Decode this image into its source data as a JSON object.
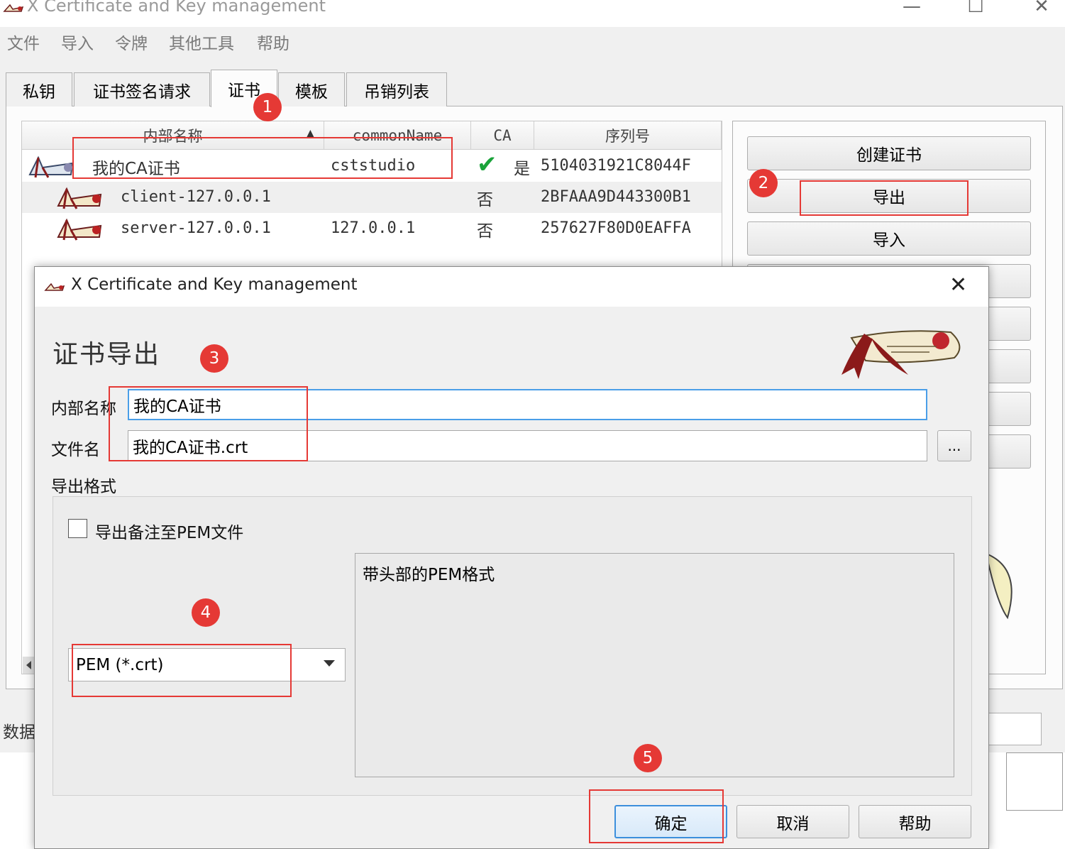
{
  "app": {
    "title": "X Certificate and Key management",
    "window_controls": {
      "minimize": "—",
      "maximize": "☐",
      "close": "✕"
    }
  },
  "menu": [
    "文件",
    "导入",
    "令牌",
    "其他工具",
    "帮助"
  ],
  "tabs": [
    {
      "label": "私钥",
      "active": false
    },
    {
      "label": "证书签名请求",
      "active": false
    },
    {
      "label": "证书",
      "active": true
    },
    {
      "label": "模板",
      "active": false
    },
    {
      "label": "吊销列表",
      "active": false
    }
  ],
  "cert_table": {
    "columns": [
      "内部名称",
      "commonName",
      "CA",
      "序列号"
    ],
    "sort_indicator": "▲",
    "rows": [
      {
        "name": "我的CA证书",
        "common_name": "cststudio",
        "ca": "是",
        "ca_check": "✔",
        "serial": "5104031921C8044F"
      },
      {
        "name": "client-127.0.0.1",
        "common_name": "",
        "ca": "否",
        "ca_check": "",
        "serial": "2BFAAA9D443300B1"
      },
      {
        "name": "server-127.0.0.1",
        "common_name": "127.0.0.1",
        "ca": "否",
        "ca_check": "",
        "serial": "257627F80D0EAFFA"
      }
    ]
  },
  "side_buttons": [
    "创建证书",
    "导出",
    "导入"
  ],
  "status_label": "数据",
  "dialog": {
    "title": "X Certificate and Key management",
    "close": "✕",
    "heading": "证书导出",
    "internal_name_label": "内部名称",
    "internal_name_value": "我的CA证书",
    "filename_label": "文件名",
    "filename_value": "我的CA证书.crt",
    "browse_label": "...",
    "format_label": "导出格式",
    "checkbox_label": "导出备注至PEM文件",
    "checkbox_checked": false,
    "format_selected": "PEM (*.crt)",
    "format_description": "带头部的PEM格式",
    "buttons": {
      "ok": "确定",
      "cancel": "取消",
      "help": "帮助"
    }
  },
  "annotations": [
    "1",
    "2",
    "3",
    "4",
    "5"
  ],
  "colors": {
    "annotation_red": "#e53935",
    "focus_blue": "#4a9ee8",
    "check_green": "#1aa33a"
  }
}
